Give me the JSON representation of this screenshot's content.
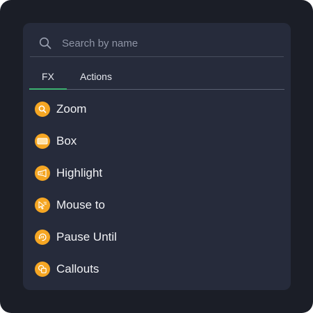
{
  "search": {
    "placeholder": "Search by name",
    "value": ""
  },
  "tabs": [
    {
      "label": "FX",
      "active": true
    },
    {
      "label": "Actions",
      "active": false
    }
  ],
  "items": [
    {
      "label": "Zoom",
      "icon": "zoom-icon"
    },
    {
      "label": "Box",
      "icon": "box-icon"
    },
    {
      "label": "Highlight",
      "icon": "highlight-icon"
    },
    {
      "label": "Mouse to",
      "icon": "mouse-to-icon"
    },
    {
      "label": "Pause Until",
      "icon": "pause-until-icon"
    },
    {
      "label": "Callouts",
      "icon": "callouts-icon"
    }
  ],
  "colors": {
    "background": "#1b1e27",
    "panel": "#262b3b",
    "accent": "#f5a623",
    "active_tab": "#3cb371",
    "text": "#f1f2f5"
  }
}
